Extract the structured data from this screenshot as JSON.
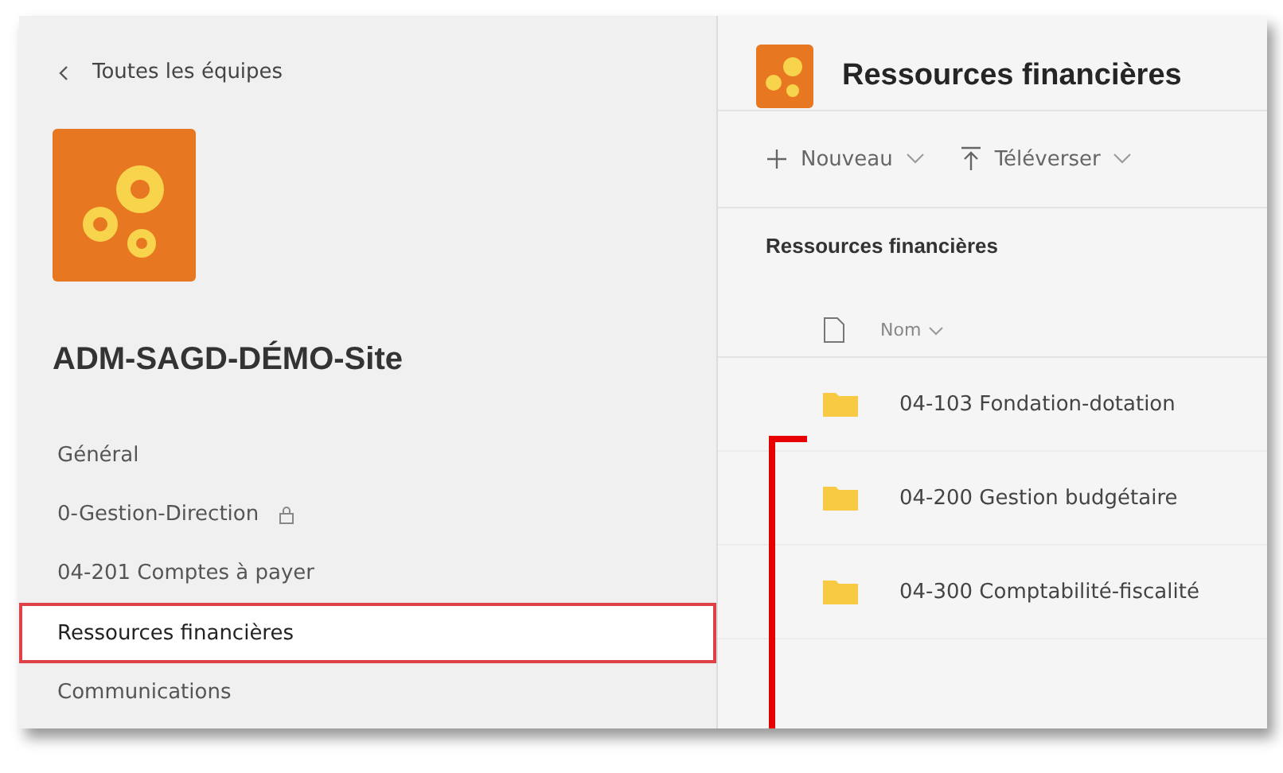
{
  "sidebar": {
    "back_link": "Toutes les équipes",
    "team_name": "ADM-SAGD-DÉMO-Site",
    "channels": [
      {
        "name": "Général",
        "locked": false,
        "selected": false
      },
      {
        "name": "0-Gestion-Direction",
        "locked": true,
        "selected": false
      },
      {
        "name": "04-201 Comptes à payer",
        "locked": false,
        "selected": false
      },
      {
        "name": "Ressources financières",
        "locked": false,
        "selected": true
      },
      {
        "name": "Communications",
        "locked": false,
        "selected": false
      }
    ]
  },
  "main": {
    "title": "Ressources financières",
    "toolbar": [
      {
        "kind": "new",
        "label": "Nouveau"
      },
      {
        "kind": "upload",
        "label": "Téléverser"
      }
    ],
    "breadcrumb": "Ressources financières",
    "column": "Nom",
    "files": [
      {
        "name": "04-103 Fondation-dotation"
      },
      {
        "name": "04-200 Gestion budgétaire"
      },
      {
        "name": "04-300 Comptabilité-fiscalité"
      }
    ]
  }
}
